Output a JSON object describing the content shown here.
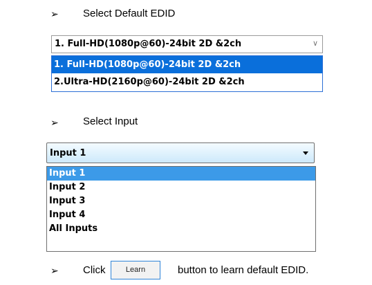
{
  "steps": [
    {
      "bullet": "➢",
      "text": "Select Default EDID"
    },
    {
      "bullet": "➢",
      "text": "Select Input"
    },
    {
      "bullet": "➢",
      "text_before": "Click",
      "text_after": "button to learn default EDID."
    }
  ],
  "edid": {
    "selected": "1. Full-HD(1080p@60)-24bit 2D &2ch",
    "chevron": "∨",
    "options": [
      "1. Full-HD(1080p@60)-24bit 2D &2ch",
      "2.Ultra-HD(2160p@60)-24bit 2D &2ch"
    ]
  },
  "input": {
    "selected": "Input 1",
    "options": [
      "Input 1",
      "Input 2",
      "Input 3",
      "Input 4",
      "All Inputs"
    ]
  },
  "learn_button": {
    "label": "Learn"
  }
}
